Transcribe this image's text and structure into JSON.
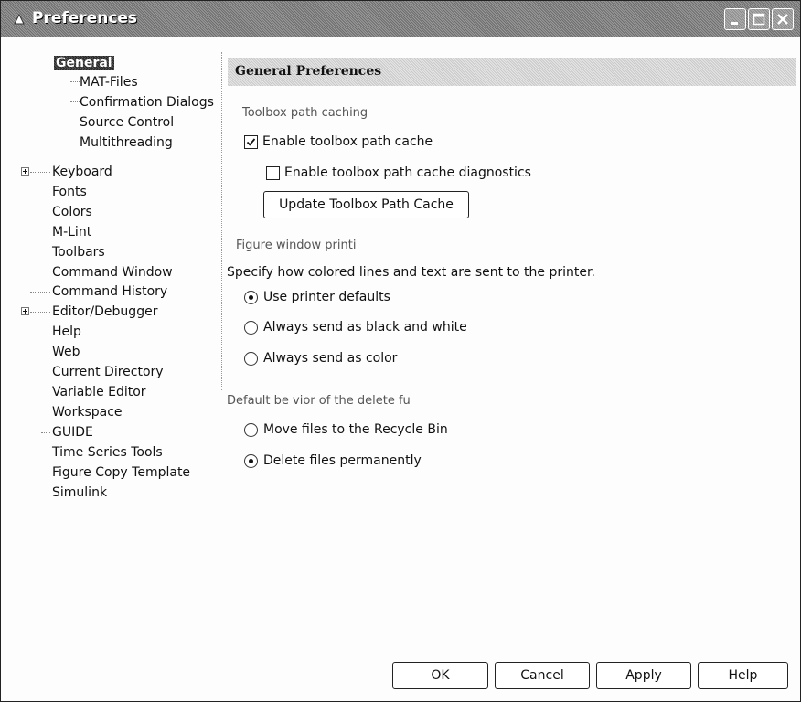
{
  "window": {
    "title": "Preferences"
  },
  "tree": {
    "items": [
      {
        "label": "General"
      },
      {
        "label": "MAT-Files"
      },
      {
        "label": "Confirmation Dialogs"
      },
      {
        "label": "Source Control"
      },
      {
        "label": "Multithreading"
      },
      {
        "label": "Keyboard"
      },
      {
        "label": "Fonts"
      },
      {
        "label": "Colors"
      },
      {
        "label": "M-Lint"
      },
      {
        "label": "Toolbars"
      },
      {
        "label": "Command Window"
      },
      {
        "label": "Command History"
      },
      {
        "label": "Editor/Debugger"
      },
      {
        "label": "Help"
      },
      {
        "label": "Web"
      },
      {
        "label": "Current Directory"
      },
      {
        "label": "Variable Editor"
      },
      {
        "label": "Workspace"
      },
      {
        "label": "GUIDE"
      },
      {
        "label": "Time Series Tools"
      },
      {
        "label": "Figure Copy Template"
      },
      {
        "label": "Simulink"
      }
    ]
  },
  "panel": {
    "title": "General Preferences",
    "toolbox": {
      "section": "Toolbox path caching",
      "enable_cache": {
        "label": "Enable toolbox path cache",
        "checked": true
      },
      "enable_diag": {
        "label": "Enable toolbox path cache diagnostics",
        "checked": false
      },
      "update_button": "Update Toolbox Path Cache"
    },
    "printing": {
      "section": "Figure window printi",
      "description": "Specify how colored lines and text are sent to the printer.",
      "options": [
        {
          "label": "Use printer defaults",
          "selected": true
        },
        {
          "label": "Always send as black and white",
          "selected": false
        },
        {
          "label": "Always send as color",
          "selected": false
        }
      ]
    },
    "delete": {
      "section": "Default be vior of the delete fu",
      "options": [
        {
          "label": "Move files to the Recycle Bin",
          "selected": false
        },
        {
          "label": "Delete files permanently",
          "selected": true
        }
      ]
    }
  },
  "buttons": {
    "ok": "OK",
    "cancel": "Cancel",
    "apply": "Apply",
    "help": "Help"
  }
}
